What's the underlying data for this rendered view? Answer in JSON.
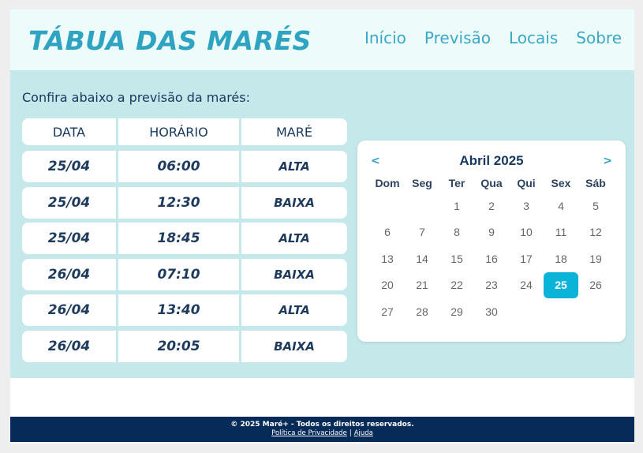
{
  "header": {
    "brand": "TÁBUA DAS MARÉS",
    "nav": [
      "Início",
      "Previsão",
      "Locais",
      "Sobre"
    ]
  },
  "main": {
    "intro": "Confira abaixo a previsão da marés:"
  },
  "table": {
    "columns": [
      "DATA",
      "HORÁRIO",
      "MARÉ"
    ],
    "rows": [
      {
        "date": "25/04",
        "time": "06:00",
        "tide": "ALTA"
      },
      {
        "date": "25/04",
        "time": "12:30",
        "tide": "BAIXA"
      },
      {
        "date": "25/04",
        "time": "18:45",
        "tide": "ALTA"
      },
      {
        "date": "26/04",
        "time": "07:10",
        "tide": "BAIXA"
      },
      {
        "date": "26/04",
        "time": "13:40",
        "tide": "ALTA"
      },
      {
        "date": "26/04",
        "time": "20:05",
        "tide": "BAIXA"
      }
    ]
  },
  "calendar": {
    "prev": "<",
    "next": ">",
    "title": "Abril 2025",
    "weekdays": [
      "Dom",
      "Seg",
      "Ter",
      "Qua",
      "Qui",
      "Sex",
      "Sáb"
    ],
    "days": [
      "",
      "",
      "1",
      "2",
      "3",
      "4",
      "5",
      "6",
      "7",
      "8",
      "9",
      "10",
      "11",
      "12",
      "13",
      "14",
      "15",
      "16",
      "17",
      "18",
      "19",
      "20",
      "21",
      "22",
      "23",
      "24",
      "25",
      "26",
      "27",
      "28",
      "29",
      "30"
    ],
    "selected": "25"
  },
  "footer": {
    "copyright": "© 2025 Maré+ - Todos os direitos reservados.",
    "privacy": "Política de Privacidade",
    "separator": "|",
    "help": "Ajuda"
  },
  "colors": {
    "brand": "#2fa4c2",
    "main_bg": "#c5e9eb",
    "footer_bg": "#062b58",
    "selected_day": "#0ab3d8"
  }
}
